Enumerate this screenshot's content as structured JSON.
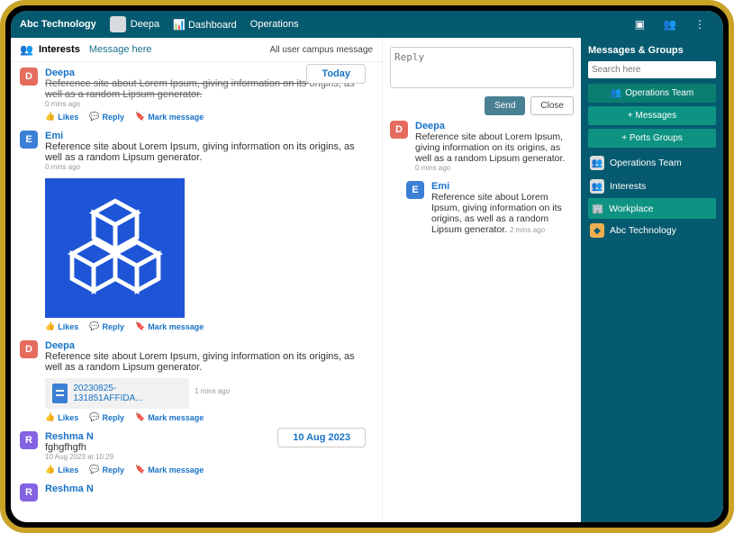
{
  "top": {
    "brand": "Abc Technology",
    "user": "Deepa",
    "tab_dashboard": "Dashboard",
    "tab_operations": "Operations"
  },
  "feed_header": {
    "title": "Interests",
    "subtitle": "Message here",
    "right": "All user campus message"
  },
  "date_labels": {
    "today": "Today",
    "aug10": "10 Aug 2023"
  },
  "actions": {
    "likes": "Likes",
    "reply": "Reply",
    "mark": "Mark message"
  },
  "posts": {
    "p1": {
      "initial": "D",
      "author": "Deepa",
      "body": "Reference site about Lorem Ipsum, giving information on its origins, as well as a random Lipsum generator.",
      "time": "0 mins ago"
    },
    "p2": {
      "initial": "E",
      "author": "Emi",
      "body": "Reference site about Lorem Ipsum, giving information on its origins, as well as a random Lipsum generator.",
      "time": "0 mins ago"
    },
    "p3": {
      "initial": "D",
      "author": "Deepa",
      "body": "Reference site about Lorem Ipsum, giving information on its origins, as well as a random Lipsum generator.",
      "file": "20230825-131851AFFIDA...",
      "file_time": "1 mins ago"
    },
    "p4": {
      "initial": "R",
      "author": "Reshma N",
      "body": "fghgfhgfh",
      "time": "10 Aug 2023 at 10:29"
    },
    "p5": {
      "initial": "R",
      "author": "Reshma N"
    }
  },
  "thread": {
    "reply_placeholder": "Reply",
    "send": "Send",
    "close": "Close",
    "t1": {
      "initial": "D",
      "author": "Deepa",
      "body": "Reference site about Lorem Ipsum, giving information on its origins, as well as a random Lipsum generator.",
      "time": "0 mins ago"
    },
    "t2": {
      "initial": "E",
      "author": "Emi",
      "body": "Reference site about Lorem Ipsum, giving information on its origins, as well as a random Lipsum generator.",
      "time_inline": "2 mins ago"
    }
  },
  "sidebar": {
    "title": "Messages & Groups",
    "search_placeholder": "Search here",
    "ops_team_btn": "Operations Team",
    "add_messages_btn": "+ Messages",
    "add_ports_btn": "+ Ports Groups",
    "grp_ops": "Operations Team",
    "grp_interests": "Interests",
    "grp_workplace": "Workplace",
    "grp_org": "Abc Technology"
  }
}
